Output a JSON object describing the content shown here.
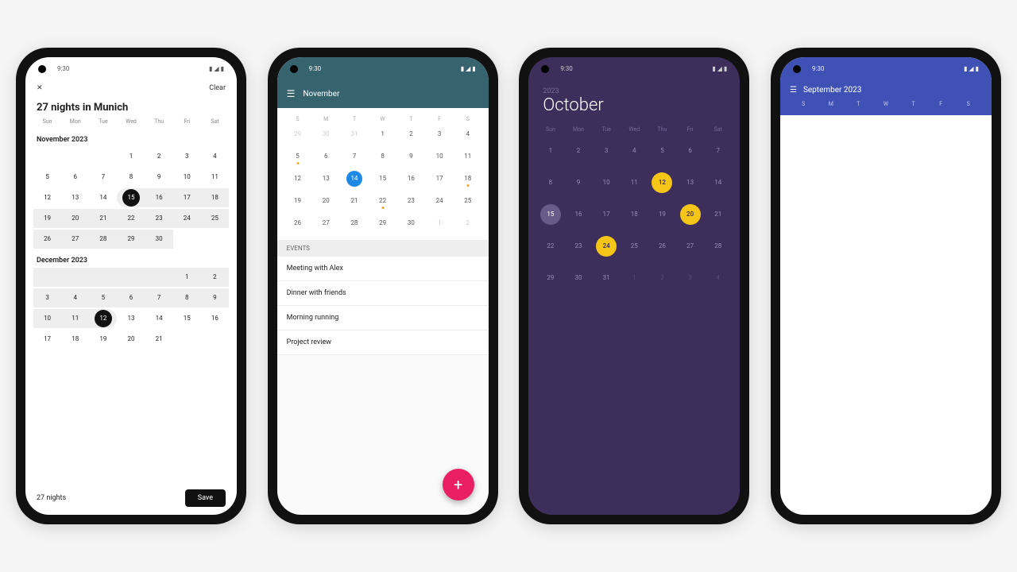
{
  "status": {
    "time": "9:30",
    "icons": "▮◢▮"
  },
  "phone1": {
    "back": "✕",
    "clear": "Clear",
    "title": "27 nights in Munich",
    "dow": [
      "Sun",
      "Mon",
      "Tue",
      "Wed",
      "Thu",
      "Fri",
      "Sat"
    ],
    "month1": "November 2023",
    "month2": "December 2023",
    "footer_info": "27 nights",
    "save": "Save",
    "selected_start": 15,
    "selected_end": 12
  },
  "phone2": {
    "appbar_title": "November",
    "dow": [
      "S",
      "M",
      "T",
      "W",
      "T",
      "F",
      "S"
    ],
    "today": 14,
    "events_header": "EVENTS",
    "events": [
      "Meeting with Alex",
      "Dinner with friends",
      "Morning running",
      "Project review"
    ],
    "fab": "+"
  },
  "phone3": {
    "year": "2023",
    "month": "October",
    "dow": [
      "Sun",
      "Mon",
      "Tue",
      "Wed",
      "Thu",
      "Fri",
      "Sat"
    ],
    "today": 15,
    "marked": [
      12,
      20,
      24
    ]
  },
  "phone4": {
    "month": "September 2023",
    "dow": [
      "S",
      "M",
      "T",
      "W",
      "T",
      "F",
      "S"
    ]
  }
}
